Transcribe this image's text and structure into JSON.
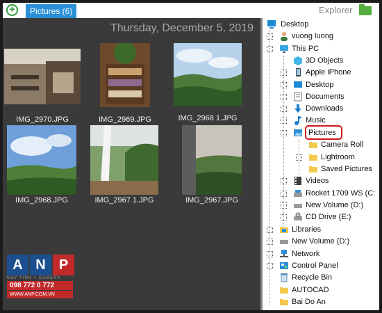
{
  "tab": {
    "label": "Pictures (6)"
  },
  "header": {
    "explorer_label": "Explorer"
  },
  "gallery": {
    "date": "Thursday, December 5, 2019",
    "images": [
      {
        "caption": "IMG_2970.JPG"
      },
      {
        "caption": "IMG_2969.JPG"
      },
      {
        "caption": "IMG_2968 1.JPG"
      },
      {
        "caption": "IMG_2968.JPG"
      },
      {
        "caption": "IMG_2967 1.JPG"
      },
      {
        "caption": "IMG_2967.JPG"
      }
    ]
  },
  "watermark": {
    "letters": [
      "A",
      "N",
      "P"
    ],
    "tagline": "MAY TINH + CAMERA",
    "phone": "098 772 0 772",
    "site": "WWW.ANP.COM.VN"
  },
  "tree": {
    "items": [
      {
        "label": "Desktop",
        "icon": "desktop-icon"
      },
      {
        "label": "vuong luong",
        "icon": "user-icon"
      },
      {
        "label": "This PC",
        "icon": "computer-icon"
      },
      {
        "label": "3D Objects",
        "icon": "cube-icon"
      },
      {
        "label": "Apple iPhone",
        "icon": "phone-icon"
      },
      {
        "label": "Desktop",
        "icon": "desktop-icon"
      },
      {
        "label": "Documents",
        "icon": "documents-icon"
      },
      {
        "label": "Downloads",
        "icon": "download-icon"
      },
      {
        "label": "Music",
        "icon": "music-icon"
      },
      {
        "label": "Pictures",
        "icon": "pictures-icon"
      },
      {
        "label": "Camera Roll",
        "icon": "folder-icon"
      },
      {
        "label": "Lightroom",
        "icon": "folder-icon"
      },
      {
        "label": "Saved Pictures",
        "icon": "folder-icon"
      },
      {
        "label": "Videos",
        "icon": "video-icon"
      },
      {
        "label": "Rocket 1709 WS (C:",
        "icon": "drive-icon"
      },
      {
        "label": "New Volume (D:)",
        "icon": "drive-icon"
      },
      {
        "label": "CD Drive (E:)",
        "icon": "cd-drive-icon"
      },
      {
        "label": "Libraries",
        "icon": "library-icon"
      },
      {
        "label": "New Volume (D:)",
        "icon": "drive-icon"
      },
      {
        "label": "Network",
        "icon": "network-icon"
      },
      {
        "label": "Control Panel",
        "icon": "control-panel-icon"
      },
      {
        "label": "Recycle Bin",
        "icon": "recycle-bin-icon"
      },
      {
        "label": "AUTOCAD",
        "icon": "folder-icon"
      },
      {
        "label": "Bai Do An",
        "icon": "folder-icon"
      }
    ]
  },
  "colors": {
    "accent": "#2b8fd8",
    "add_green": "#2e9b3c",
    "highlight_red": "#d01717",
    "gallery_bg": "#3a3a3a"
  }
}
